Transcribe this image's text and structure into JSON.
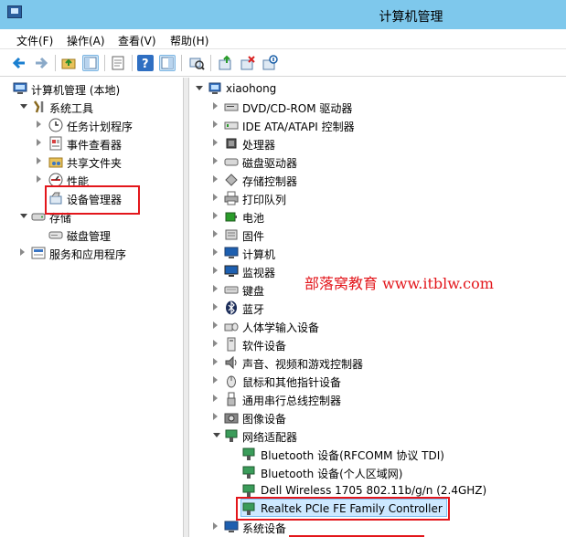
{
  "window": {
    "title": "计算机管理"
  },
  "menu": [
    "文件(F)",
    "操作(A)",
    "查看(V)",
    "帮助(H)"
  ],
  "left_tree": {
    "root": "计算机管理 (本地)",
    "system_tools": "系统工具",
    "task_scheduler": "任务计划程序",
    "event_viewer": "事件查看器",
    "shared_folders": "共享文件夹",
    "performance": "性能",
    "device_manager": "设备管理器",
    "storage": "存储",
    "disk_management": "磁盘管理",
    "services_apps": "服务和应用程序"
  },
  "right_tree": {
    "computer_name": "xiaohong",
    "categories": [
      "DVD/CD-ROM 驱动器",
      "IDE ATA/ATAPI 控制器",
      "处理器",
      "磁盘驱动器",
      "存储控制器",
      "打印队列",
      "电池",
      "固件",
      "计算机",
      "监视器",
      "键盘",
      "蓝牙",
      "人体学输入设备",
      "软件设备",
      "声音、视频和游戏控制器",
      "鼠标和其他指针设备",
      "通用串行总线控制器",
      "图像设备",
      "网络适配器"
    ],
    "network_adapters": [
      "Bluetooth 设备(RFCOMM 协议 TDI)",
      "Bluetooth 设备(个人区域网)",
      "Dell Wireless 1705 802.11b/g/n (2.4GHZ)",
      "Realtek PCIe FE Family Controller"
    ],
    "after": "系统设备"
  },
  "watermark": "部落窝教育  www.itblw.com",
  "colors": {
    "titlebar": "#7ec8ec",
    "highlight": "#e3161b",
    "selection": "#cde8ff"
  }
}
